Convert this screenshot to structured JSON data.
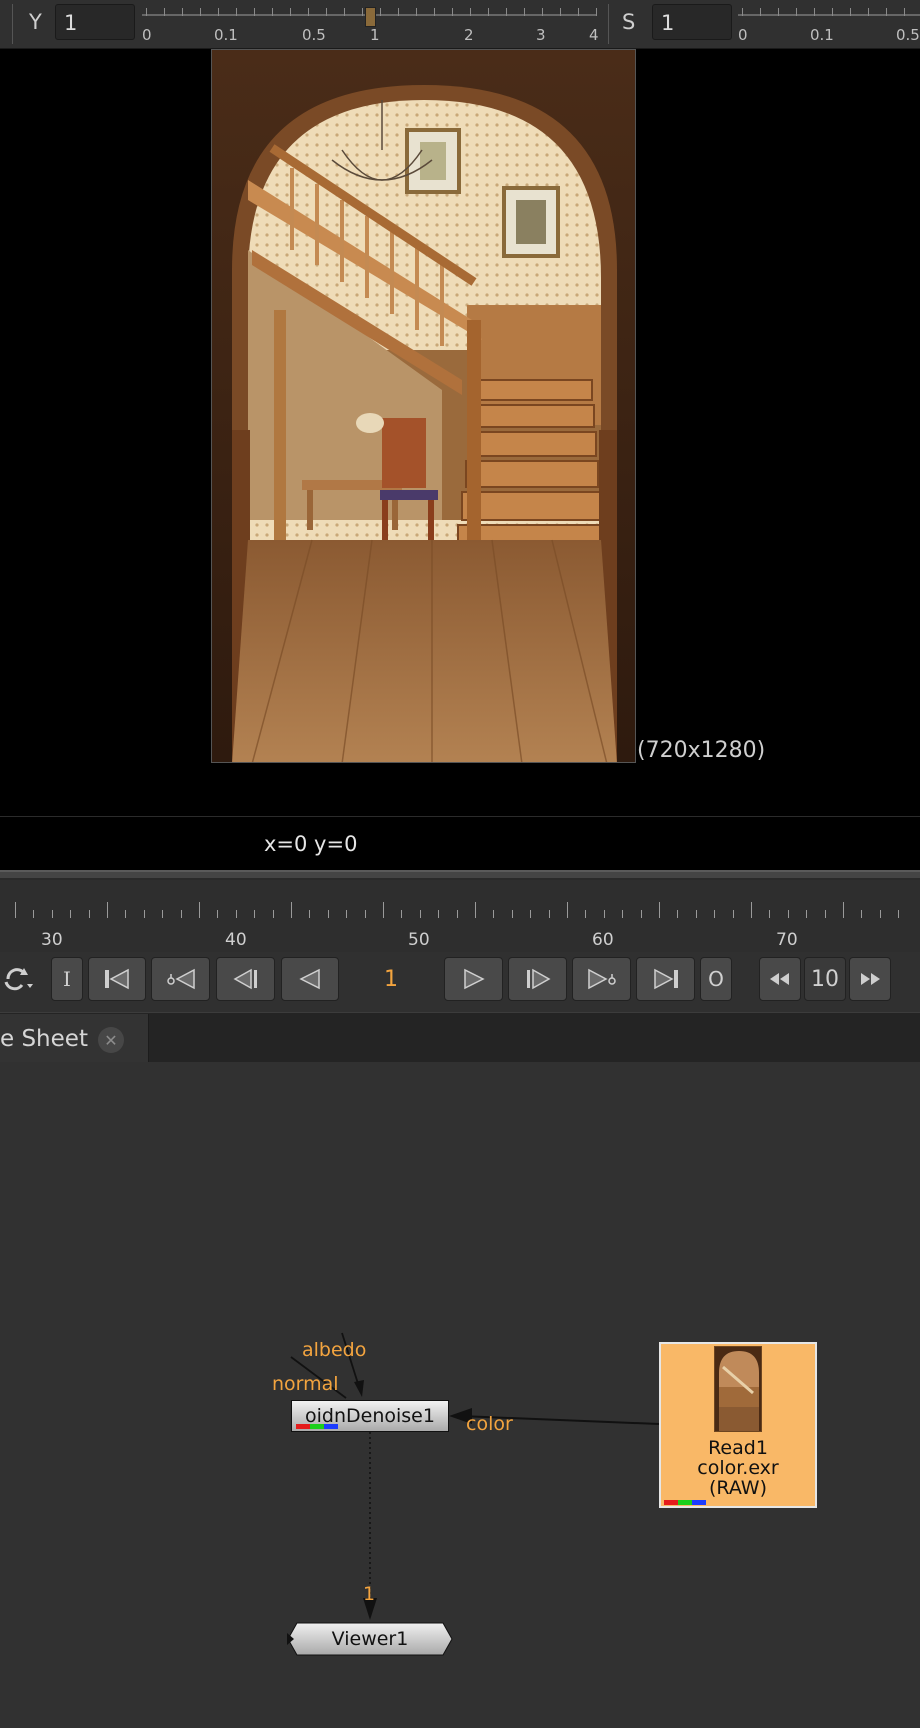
{
  "top_bar": {
    "y_label": "Y",
    "y_value": "1",
    "y_ticks": [
      "0",
      "0.1",
      "0.5",
      "1",
      "2",
      "3",
      "4"
    ],
    "s_label": "S",
    "s_value": "1",
    "s_ticks": [
      "0",
      "0.1",
      "0.5"
    ]
  },
  "viewer": {
    "resolution_label": "(720x1280)",
    "coords": "x=0 y=0"
  },
  "timeline": {
    "labels": [
      "30",
      "40",
      "50",
      "60",
      "70"
    ]
  },
  "transport": {
    "in_label": "I",
    "out_label": "O",
    "frame": "1",
    "increment": "10"
  },
  "tab": {
    "label": "e Sheet",
    "close_glyph": "✕"
  },
  "nodes": {
    "denoise": {
      "label": "oidnDenoise1",
      "inputs": {
        "albedo": "albedo",
        "normal": "normal",
        "color": "color"
      }
    },
    "read": {
      "line1": "Read1",
      "line2": "color.exr",
      "line3": "(RAW)"
    },
    "viewer": {
      "label": "Viewer1",
      "input_label": "1"
    }
  },
  "colors": {
    "accent_orange": "#f3a43f",
    "read_node": "#f9b867",
    "channel_red": "#e41c1c",
    "channel_green": "#1ccf1c",
    "channel_blue": "#1c3cff"
  }
}
